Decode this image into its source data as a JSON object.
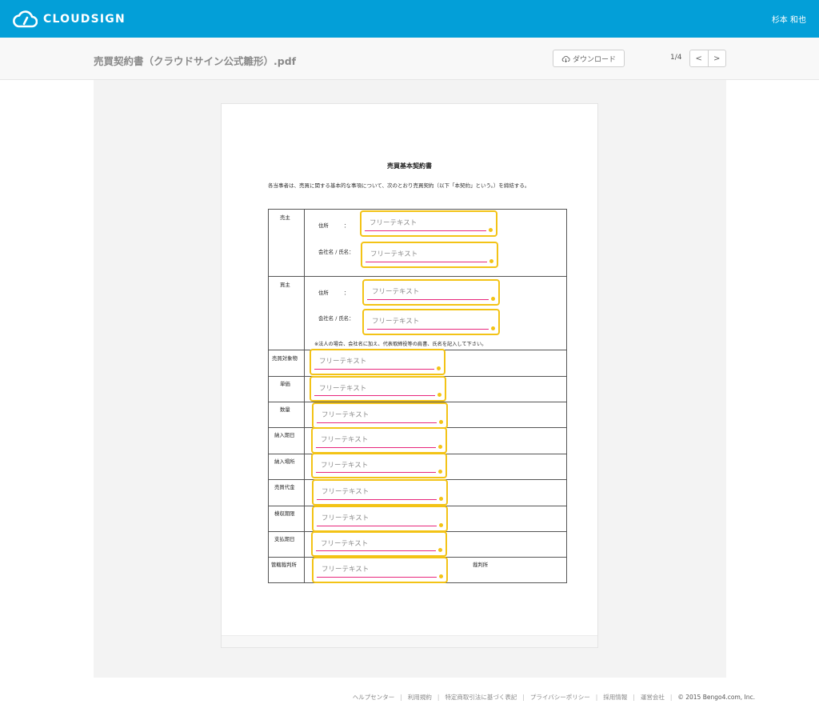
{
  "header": {
    "logo_text": "CLOUDSIGN",
    "user_name": "杉本 和也",
    "colors": {
      "bar": "#039fd8"
    }
  },
  "toolbar": {
    "doc_title": "売買契約書（クラウドサイン公式雛形）.pdf",
    "download_label": "ダウンロード",
    "page_counter": "1/4",
    "prev_label": "<",
    "next_label": ">"
  },
  "document": {
    "title": "売買基本契約書",
    "intro": "各当事者は、売買に関する基本的な事項について、次のとおり売買契約（以下「本契約」という。）を締結する。",
    "seller_label": "売主",
    "buyer_label": "買主",
    "address_label": "住所　　　：",
    "company_label": "会社名 / 氏名：",
    "note": "※法人の場合、会社名に加え、代表取締役等の肩書、氏名を記入して下さい。",
    "rows": [
      "売買対象物",
      "単価",
      "数量",
      "納入期日",
      "納入場所",
      "売買代金",
      "検収期限",
      "支払期日",
      "管轄裁判所"
    ],
    "court_suffix": "裁判所",
    "field_placeholder": "フリーテキスト",
    "field_colors": {
      "border": "#f3c316",
      "underline": "#e8277c"
    }
  },
  "footer": {
    "links": [
      "ヘルプセンター",
      "利用規約",
      "特定商取引法に基づく表記",
      "プライバシーポリシー",
      "採用情報",
      "運営会社"
    ],
    "copyright": "© 2015 Bengo4.com, Inc."
  }
}
